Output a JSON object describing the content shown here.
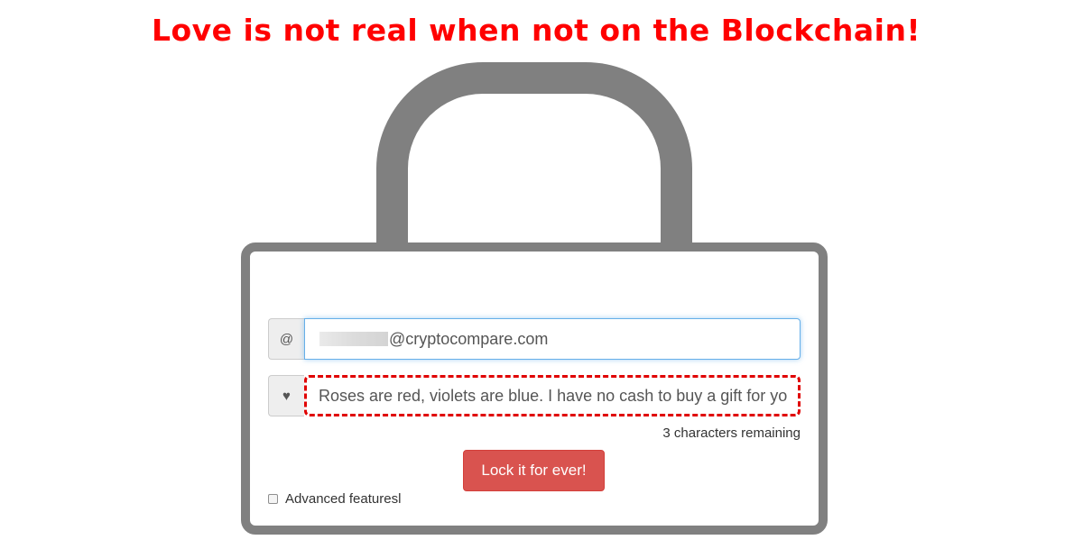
{
  "headline": "Love is not real when not on the Blockchain!",
  "email": {
    "addon_icon": "at-sign-icon",
    "addon_text": "@",
    "value_suffix": "@cryptocompare.com"
  },
  "message": {
    "addon_icon": "heart-icon",
    "addon_text": "♥",
    "value": "Roses are red, violets are blue. I have no cash to buy a gift for yo",
    "counter": "3 characters remaining"
  },
  "lock_button_label": "Lock it for ever!",
  "advanced_label": "Advanced featuresl",
  "colors": {
    "headline": "#ff0000",
    "lock_frame": "#808080",
    "button": "#d9534f",
    "highlight_border": "#e00000"
  }
}
